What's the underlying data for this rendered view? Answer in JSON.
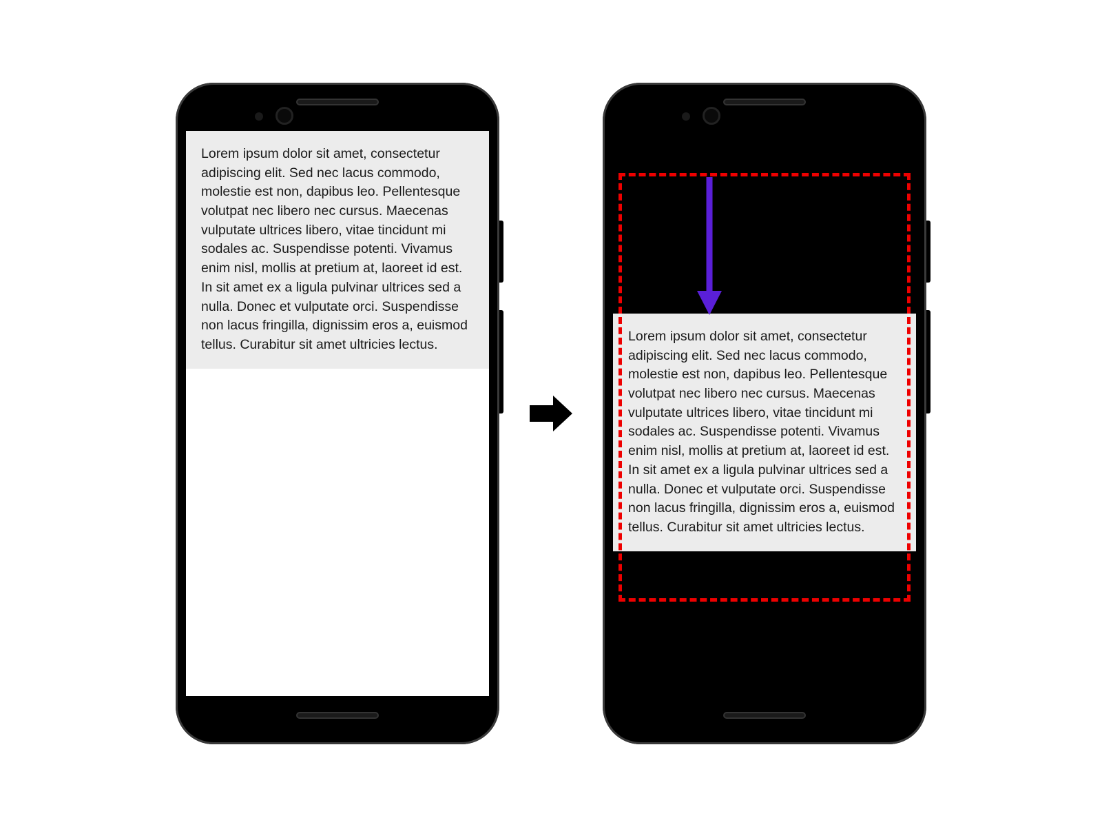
{
  "lorem_text": "Lorem ipsum dolor sit amet, consectetur adipiscing elit. Sed nec lacus commodo, molestie est non, dapibus leo. Pellentesque volutpat nec libero nec cursus. Maecenas vulputate ultrices libero, vitae tincidunt mi sodales ac. Suspendisse potenti. Vivamus enim nisl, mollis at pretium at, laoreet id est. In sit amet ex a ligula pulvinar ultrices sed a nulla. Donec et vulputate orci. Suspendisse non lacus fringilla, dignissim eros a, euismod tellus. Curabitur sit amet ultricies lectus.",
  "annotations": {
    "dashed_box_color": "#ee0000",
    "push_arrow_color": "#5a1fd8",
    "transition_arrow_color": "#000000"
  }
}
